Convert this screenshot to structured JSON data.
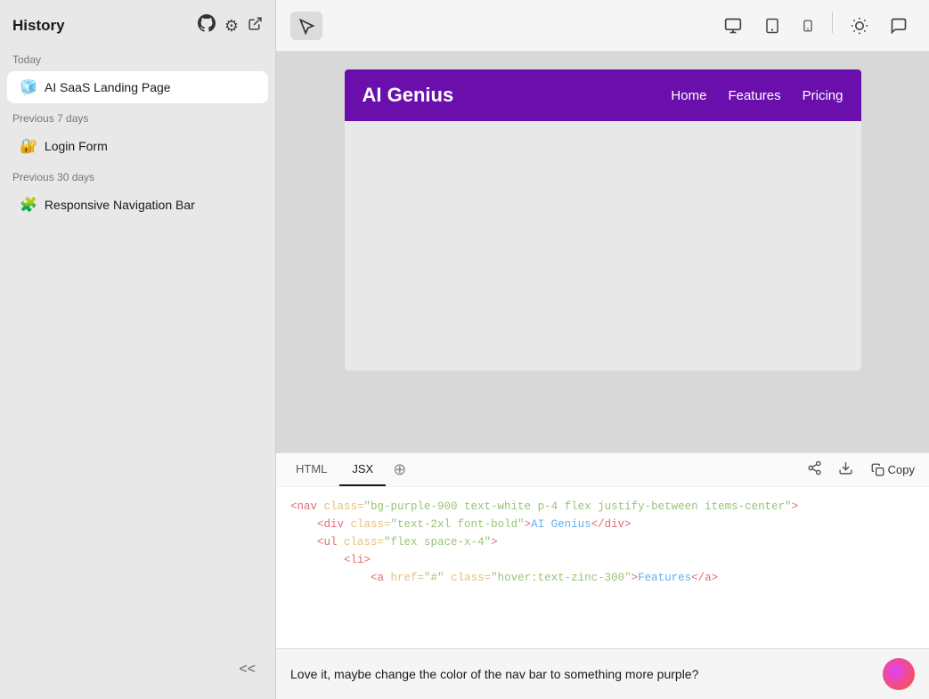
{
  "sidebar": {
    "title": "History",
    "icons": {
      "github": "⬡",
      "settings": "⚙",
      "external": "↗"
    },
    "sections": [
      {
        "label": "Today",
        "items": [
          {
            "id": "ai-saas",
            "icon": "🧊",
            "label": "AI SaaS Landing Page",
            "active": true
          }
        ]
      },
      {
        "label": "Previous 7 days",
        "items": [
          {
            "id": "login-form",
            "icon": "🔐",
            "label": "Login Form",
            "active": false
          }
        ]
      },
      {
        "label": "Previous 30 days",
        "items": [
          {
            "id": "nav-bar",
            "icon": "🧩",
            "label": "Responsive Navigation Bar",
            "active": false
          }
        ]
      }
    ],
    "collapse_label": "<<"
  },
  "toolbar": {
    "cursor_icon": "cursor",
    "desktop_icon": "desktop",
    "tablet_icon": "tablet",
    "mobile_icon": "mobile",
    "sun_icon": "sun",
    "comment_icon": "comment"
  },
  "preview": {
    "nav": {
      "brand": "AI Genius",
      "links": [
        "Home",
        "Features",
        "Pricing"
      ]
    }
  },
  "code": {
    "tabs": [
      {
        "id": "html",
        "label": "HTML",
        "active": false
      },
      {
        "id": "jsx",
        "label": "JSX",
        "active": true
      }
    ],
    "lines": [
      {
        "content": "<nav class=\"bg-purple-900 text-white p-4 flex justify-between items-center\">",
        "type": "tag"
      },
      {
        "content": "    <div class=\"text-2xl font-bold\">AI Genius</div>",
        "type": "tag-content"
      },
      {
        "content": "    <ul class=\"flex space-x-4\">",
        "type": "tag"
      },
      {
        "content": "",
        "type": "empty"
      },
      {
        "content": "        <li>",
        "type": "tag"
      },
      {
        "content": "            <a href=\"#\" class=\"hover:text-zinc-300\">Features</a>",
        "type": "tag-link"
      }
    ],
    "actions": {
      "share": "share",
      "download": "download",
      "copy": "Copy"
    }
  },
  "chat": {
    "message": "Love it, maybe change the color of the nav bar to something more purple?"
  }
}
